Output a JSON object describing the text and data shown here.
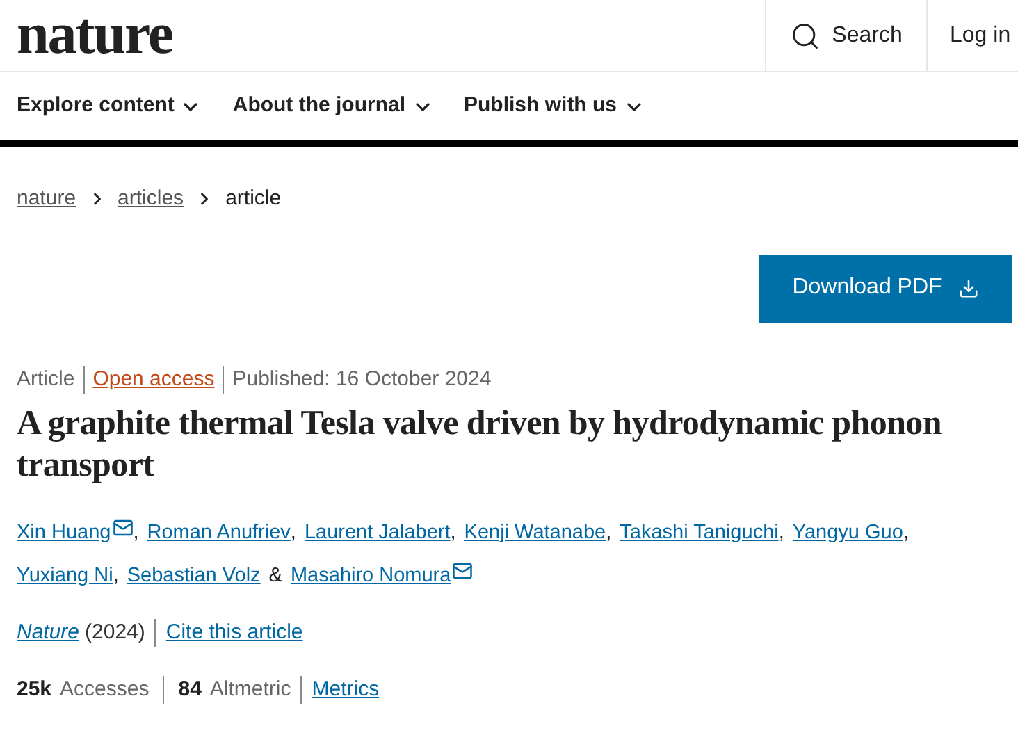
{
  "header": {
    "logo": "nature",
    "search": "Search",
    "login": "Log in"
  },
  "nav": [
    {
      "label": "Explore content"
    },
    {
      "label": "About the journal"
    },
    {
      "label": "Publish with us"
    }
  ],
  "breadcrumbs": [
    {
      "label": "nature",
      "current": false
    },
    {
      "label": "articles",
      "current": false
    },
    {
      "label": "article",
      "current": true
    }
  ],
  "download_button": "Download PDF",
  "meta": [
    {
      "label": "Article",
      "link": false
    },
    {
      "label": "Open access",
      "link": true
    },
    {
      "label": "Published: 16 October 2024",
      "link": false
    }
  ],
  "title": "A graphite thermal Tesla valve driven by hydrodynamic phonon transport",
  "authors": [
    {
      "name": "Xin Huang",
      "email": true,
      "separator": ","
    },
    {
      "name": "Roman Anufriev",
      "email": false,
      "separator": ","
    },
    {
      "name": "Laurent Jalabert",
      "email": false,
      "separator": ","
    },
    {
      "name": "Kenji Watanabe",
      "email": false,
      "separator": ","
    },
    {
      "name": "Takashi Taniguchi",
      "email": false,
      "separator": ","
    },
    {
      "name": "Yangyu Guo",
      "email": false,
      "separator": ","
    },
    {
      "name": "Yuxiang Ni",
      "email": false,
      "separator": ","
    },
    {
      "name": "Sebastian Volz",
      "email": false,
      "separator": "&"
    },
    {
      "name": "Masahiro Nomura",
      "email": true
    }
  ],
  "citation": {
    "journal": "Nature",
    "year": "(2024)",
    "cite": "Cite this article"
  },
  "metrics": [
    {
      "count": "25k",
      "name": "Accesses"
    },
    {
      "count": "84",
      "name": "Altmetric"
    }
  ],
  "metrics_link": "Metrics"
}
